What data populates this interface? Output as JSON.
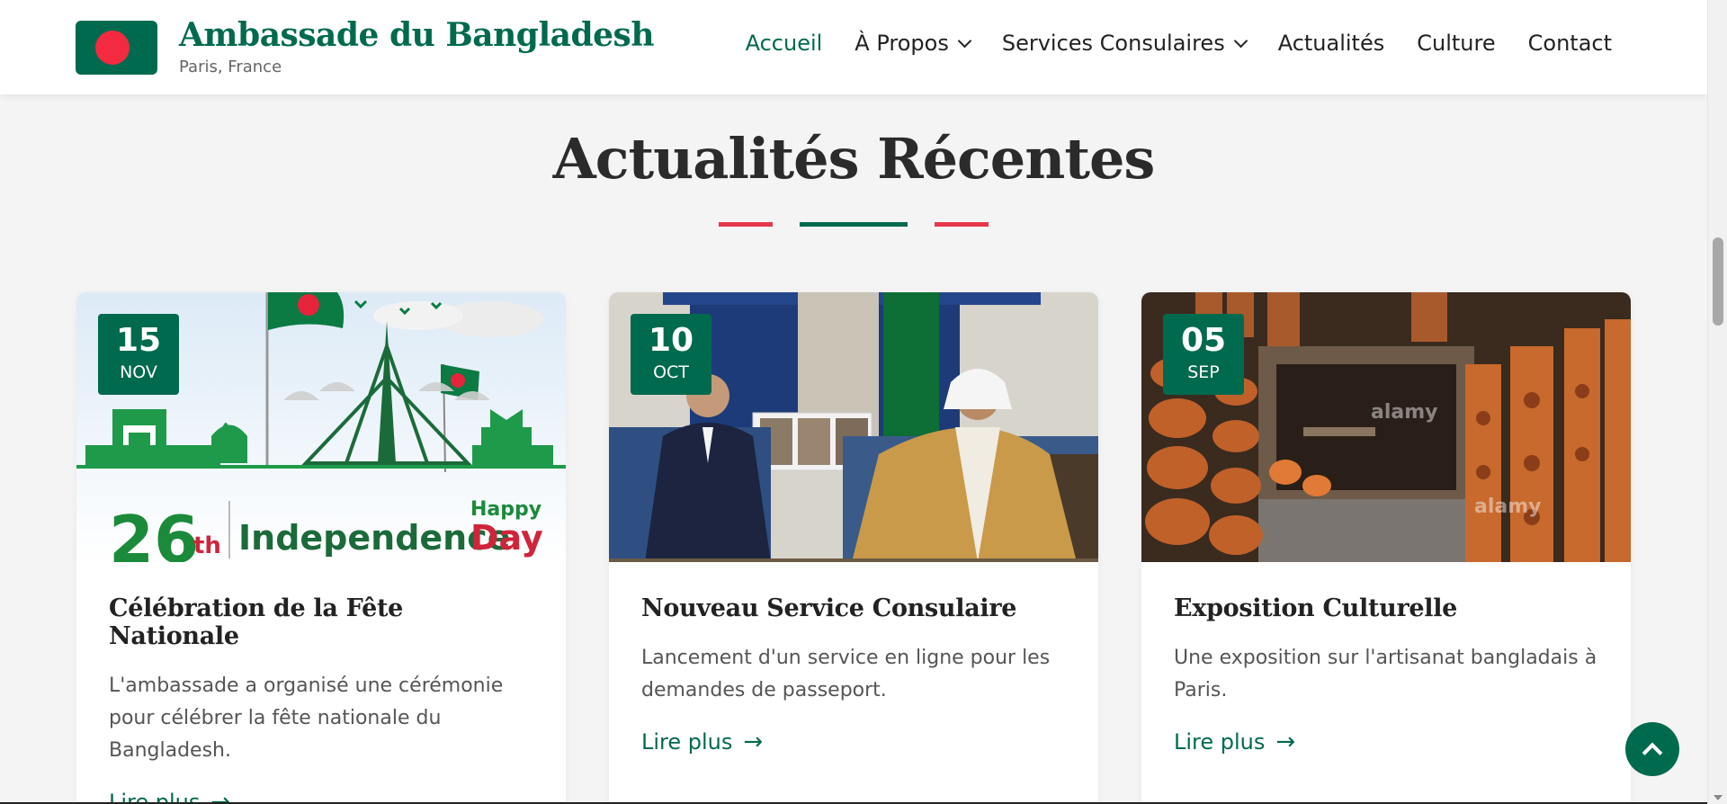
{
  "header": {
    "title": "Ambassade du Bangladesh",
    "subtitle": "Paris, France",
    "logo_icon": "bangladesh-flag-icon",
    "colors": {
      "primary": "#006a4e",
      "accent": "#f42a41"
    }
  },
  "nav": {
    "items": [
      {
        "label": "Accueil",
        "active": true,
        "dropdown": false
      },
      {
        "label": "À Propos",
        "active": false,
        "dropdown": true
      },
      {
        "label": "Services Consulaires",
        "active": false,
        "dropdown": true
      },
      {
        "label": "Actualités",
        "active": false,
        "dropdown": false
      },
      {
        "label": "Culture",
        "active": false,
        "dropdown": false
      },
      {
        "label": "Contact",
        "active": false,
        "dropdown": false
      }
    ]
  },
  "section": {
    "title": "Actualités Récentes"
  },
  "news": [
    {
      "day": "15",
      "month": "NOV",
      "title": "Célébration de la Fête Nationale",
      "text": "L'ambassade a organisé une cérémonie pour célébrer la fête nationale du Bangladesh.",
      "read_more": "Lire plus",
      "image_text": {
        "number": "26",
        "suffix": "th",
        "main": "Independence",
        "happy": "Happy",
        "day": "Day"
      }
    },
    {
      "day": "10",
      "month": "OCT",
      "title": "Nouveau Service Consulaire",
      "text": "Lancement d'un service en ligne pour les demandes de passeport.",
      "read_more": "Lire plus"
    },
    {
      "day": "05",
      "month": "SEP",
      "title": "Exposition Culturelle",
      "text": "Une exposition sur l'artisanat bangladais à Paris.",
      "read_more": "Lire plus",
      "image_text": {
        "watermark": "alamy"
      }
    }
  ],
  "icons": {
    "chevron": "chevron-down-icon",
    "arrow": "arrow-right-icon",
    "scroll_top": "chevron-up-icon"
  }
}
